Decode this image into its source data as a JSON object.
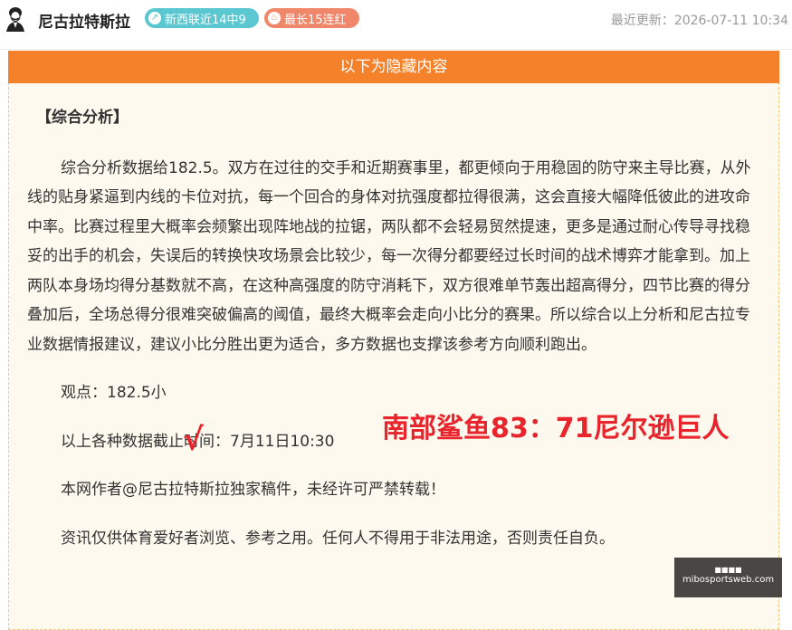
{
  "header": {
    "author": "尼古拉特斯拉",
    "badge_recent": "新西联近14中9",
    "badge_streak": "最长15连红",
    "update_time": "最近更新：2026-07-11 10:34",
    "icons": {
      "avatar": "tesla-avatar-icon",
      "badge_recent": "trend-up-icon",
      "badge_streak": "flame-icon"
    },
    "colors": {
      "badge_recent": "#5bc7d0",
      "badge_streak": "#f0876a"
    }
  },
  "hidden_box": {
    "header": "以下为隐藏内容",
    "colors": {
      "header_bg": "#f5822a",
      "box_bg": "#fef9ee",
      "accent_red": "#e8242c"
    },
    "section_title": "【综合分析】",
    "paragraph": "综合分析数据给182.5。双方在过往的交手和近期赛事里，都更倾向于用稳固的防守来主导比赛，从外线的贴身紧逼到内线的卡位对抗，每一个回合的身体对抗强度都拉得很满，这会直接大幅降低彼此的进攻命中率。比赛过程里大概率会频繁出现阵地战的拉锯，两队都不会轻易贸然提速，更多是通过耐心传导寻找稳妥的出手的机会，失误后的转换快攻场景会比较少，每一次得分都要经过长时间的战术博弈才能拿到。加上两队本身场均得分基数就不高，在这种高强度的防守消耗下，双方很难单节轰出超高得分，四节比赛的得分叠加后，全场总得分很难突破偏高的阈值，最终大概率会走向小比分的赛果。所以综合以上分析和尼古拉专业数据情报建议，建议小比分胜出更为适合，多方数据也支撑该参考方向顺利跑出。",
    "viewpoint": "观点：182.5小",
    "check_mark": "√",
    "result": "南部鲨鱼83：71尼尔逊巨人",
    "cutoff": "以上各种数据截止时间：7月11日10:30",
    "copyright": "本网作者@尼古拉特斯拉独家稿件，未经许可严禁转载！",
    "disclaimer": "资讯仅供体育爱好者浏览、参考之用。任何人不得用于非法用途，否则责任自负。"
  },
  "watermark": {
    "line1": "■■■■",
    "line2": "mibosportsweb.com"
  }
}
